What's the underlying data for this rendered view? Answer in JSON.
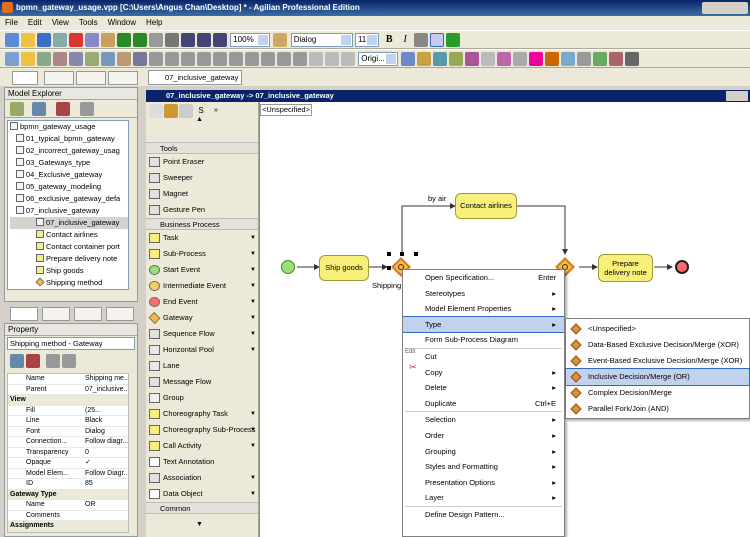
{
  "window": {
    "title": "bpmn_gateway_usage.vpp [C:\\Users\\Angus Chan\\Desktop] * - Agilian Professional Edition"
  },
  "menu": [
    "File",
    "Edit",
    "View",
    "Tools",
    "Window",
    "Help"
  ],
  "toolbar": {
    "zoom": "100%",
    "font": "Dialog",
    "font_size": "11",
    "orientation": "Origi..."
  },
  "model_explorer": {
    "title": "Model Explorer",
    "root": "bpmn_gateway_usage",
    "items": [
      "01_typical_bpmn_gateway",
      "02_incorrect_gateway_usag",
      "03_Gateways_type",
      "04_Exclusive_gateway",
      "05_gateway_modeling",
      "06_exclusive_gateway_defa",
      "07_inclusive_gateway"
    ],
    "children": [
      "07_inclusive_gateway",
      "Contact airlines",
      "Contact container port",
      "Prepare delivery note",
      "Ship goods",
      "Shipping method"
    ]
  },
  "tabs": {
    "editor_tab": "07_inclusive_gateway"
  },
  "breadcrumb": "07_inclusive_gateway -> 07_inclusive_gateway",
  "lane_label": "<Unspecified>",
  "palette": {
    "tools_title": "Tools",
    "tools": [
      "Point Eraser",
      "Sweeper",
      "Magnet",
      "Gesture Pen"
    ],
    "bp_title": "Business Process",
    "bp": [
      "Task",
      "Sub-Process",
      "Start Event",
      "Intermediate Event",
      "End Event",
      "Gateway",
      "Sequence Flow",
      "Horizontal Pool",
      "Lane",
      "Message Flow",
      "Group",
      "Choreography Task",
      "Choreography Sub-Process",
      "Call Activity",
      "Text Annotation",
      "Association",
      "Data Object"
    ],
    "common_title": "Common"
  },
  "property": {
    "title": "Property",
    "selector": "Shipping method - Gateway",
    "rows": [
      {
        "k": "Name",
        "v": "Shipping me..."
      },
      {
        "k": "Parent",
        "v": "07_inclusive..."
      },
      {
        "g": "View"
      },
      {
        "k": "Fill",
        "v": "(25..."
      },
      {
        "k": "Line",
        "v": "Black"
      },
      {
        "k": "Font",
        "v": "Dialog"
      },
      {
        "k": "Connection...",
        "v": "Follow diagr..."
      },
      {
        "k": "Transparency",
        "v": "0"
      },
      {
        "k": "Opaque",
        "v": "✓"
      },
      {
        "k": "Model Elem...",
        "v": "Follow Diagr..."
      },
      {
        "k": "ID",
        "v": "85"
      },
      {
        "g": "Gateway Type"
      },
      {
        "k": "Name",
        "v": "OR"
      },
      {
        "k": "Comments",
        "v": ""
      },
      {
        "g": "Assignments"
      }
    ]
  },
  "diagram": {
    "by_air": "by air",
    "contact_airlines": "Contact airlines",
    "ship_goods": "Ship goods",
    "prepare_note": "Prepare delivery note",
    "shipping_label": "Shipping"
  },
  "context_menu": {
    "items": [
      {
        "label": "Open Specification...",
        "sc": "Enter"
      },
      {
        "label": "Stereotypes",
        "sub": true
      },
      {
        "label": "Model Element Properties",
        "sub": true
      },
      {
        "label": "Type",
        "sub": true,
        "sel": true
      },
      {
        "label": "Form Sub-Process Diagram"
      },
      {
        "sep": true
      },
      {
        "label": "Cut"
      },
      {
        "label": "Copy",
        "sub": true
      },
      {
        "label": "Delete",
        "sub": true
      },
      {
        "label": "Duplicate",
        "sc": "Ctrl+E"
      },
      {
        "sep": true
      },
      {
        "label": "Selection",
        "sub": true
      },
      {
        "label": "Order",
        "sub": true
      },
      {
        "label": "Grouping",
        "sub": true
      },
      {
        "label": "Styles and Formatting",
        "sub": true
      },
      {
        "label": "Presentation Options",
        "sub": true
      },
      {
        "label": "Layer",
        "sub": true
      },
      {
        "sep": true
      },
      {
        "label": "Define Design Pattern..."
      }
    ],
    "edit_hint": "Edit"
  },
  "type_submenu": [
    "<Unspecified>",
    "Data-Based Exclusive Decision/Merge (XOR)",
    "Event-Based Exclusive Decision/Merge (XOR)",
    "Inclusive Decision/Merge (OR)",
    "Complex Decision/Merge",
    "Parallel Fork/Join (AND)"
  ],
  "type_selected_index": 3
}
